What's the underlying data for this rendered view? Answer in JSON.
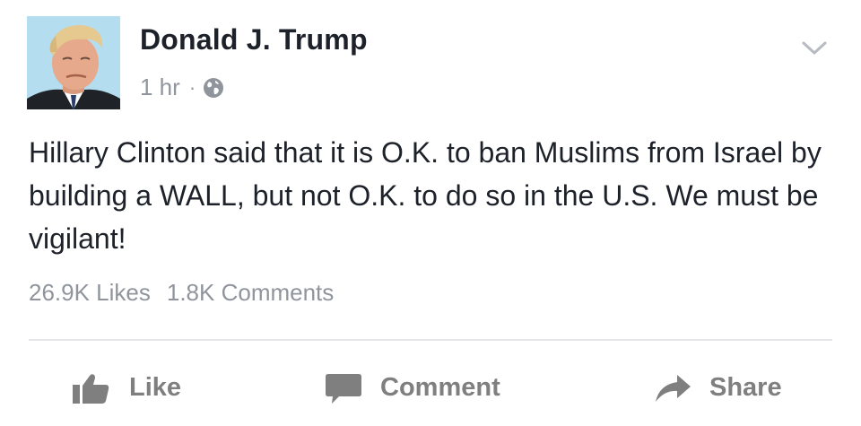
{
  "post": {
    "author": "Donald J. Trump",
    "time": "1 hr",
    "separator": "·",
    "privacy_icon": "globe-icon",
    "text": "Hillary Clinton said that it is O.K. to ban Muslims from Israel by building a WALL, but not O.K. to do so in the U.S. We must be vigilant!",
    "likes": "26.9K Likes",
    "comments": "1.8K Comments"
  },
  "actions": {
    "like": "Like",
    "comment": "Comment",
    "share": "Share"
  },
  "colors": {
    "text": "#1d2129",
    "secondary": "#90949c",
    "action": "#7f7f7f",
    "divider": "#e5e6e9"
  }
}
